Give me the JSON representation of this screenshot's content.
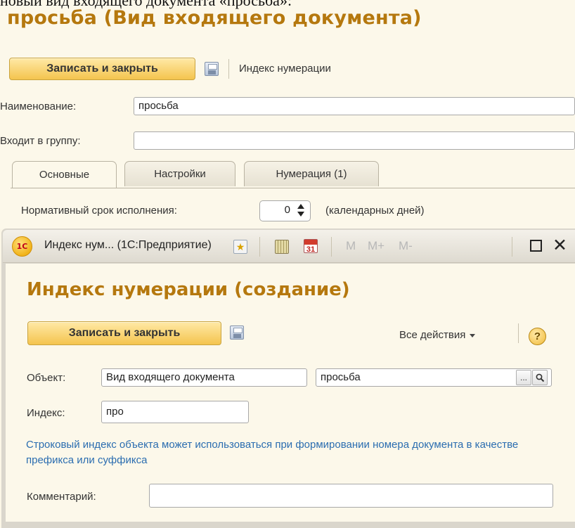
{
  "top_caption": "новый вид входящего документа «просьба»:",
  "form": {
    "title": "просьба (Вид входящего документа)",
    "save_close_label": "Записать и закрыть",
    "index_link": "Индекс нумерации",
    "name_label": "Наименование:",
    "name_value": "просьба",
    "group_label": "Входит в группу:",
    "group_value": "",
    "tabs": [
      "Основные",
      "Настройки",
      "Нумерация (1)"
    ],
    "active_tab": "Основные",
    "term_label": "Нормативный срок исполнения:",
    "term_value": "0",
    "term_units": "(календарных дней)"
  },
  "dialog": {
    "logo": "1С",
    "window_title": "Индекс нум... (1С:Предприятие)",
    "calendar_day": "31",
    "m_buttons": [
      "M",
      "M+",
      "M-"
    ],
    "close_glyph": "✕",
    "heading": "Индекс нумерации (создание)",
    "save_close_label": "Записать и закрыть",
    "all_actions_label": "Все действия",
    "help_glyph": "?",
    "object_label": "Объект:",
    "object_type_value": "Вид входящего документа",
    "object_value": "просьба",
    "select_glyph": "...",
    "index_label": "Индекс:",
    "index_value": "про",
    "hint_text": "Строковый индекс объекта может использоваться при формировании номера документа в качестве префикса или суффикса",
    "comment_label": "Комментарий:",
    "comment_value": ""
  },
  "icons": [
    "save-icon",
    "favorite-star-icon",
    "calculator-icon",
    "calendar-icon",
    "search-icon",
    "maximize-icon",
    "close-icon",
    "help-icon",
    "spin-up-icon",
    "spin-down-icon",
    "dropdown-arrow-icon"
  ],
  "colors": {
    "title": "#b5780e",
    "background": "#fcf8ea",
    "hint": "#2b6db0",
    "button_gradient_top": "#ffe9a6",
    "button_gradient_bottom": "#f4c44e"
  }
}
